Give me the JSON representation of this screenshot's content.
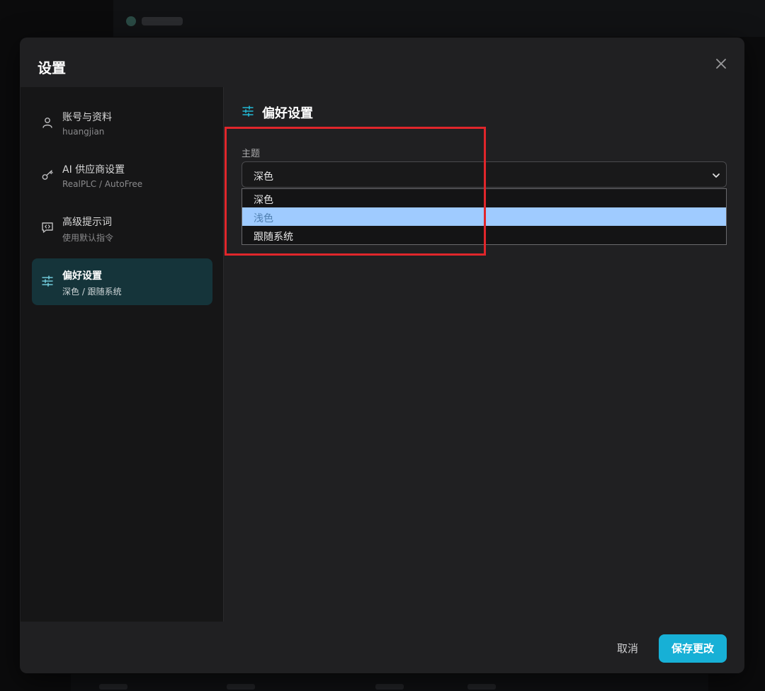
{
  "dialog": {
    "title": "设置"
  },
  "sidebar": {
    "items": [
      {
        "label": "账号与资料",
        "sub": "huangjian",
        "icon": "user-icon",
        "active": false
      },
      {
        "label": "AI 供应商设置",
        "sub": "RealPLC / AutoFree",
        "icon": "key-icon",
        "active": false
      },
      {
        "label": "高级提示词",
        "sub": "使用默认指令",
        "icon": "message-code-icon",
        "active": false
      },
      {
        "label": "偏好设置",
        "sub": "深色 / 跟随系统",
        "icon": "sliders-icon",
        "active": true
      }
    ]
  },
  "content": {
    "section_title": "偏好设置",
    "section_icon": "sliders-icon",
    "theme": {
      "label": "主题",
      "selected": "深色",
      "options": [
        "深色",
        "浅色",
        "跟随系统"
      ],
      "hovered": "浅色"
    }
  },
  "footer": {
    "cancel_label": "取消",
    "save_label": "保存更改"
  },
  "colors": {
    "accent": "#17b0d6",
    "active_item_bg": "#15343a",
    "option_hover": "#9fcbff",
    "annotation_box": "#e0262b"
  }
}
